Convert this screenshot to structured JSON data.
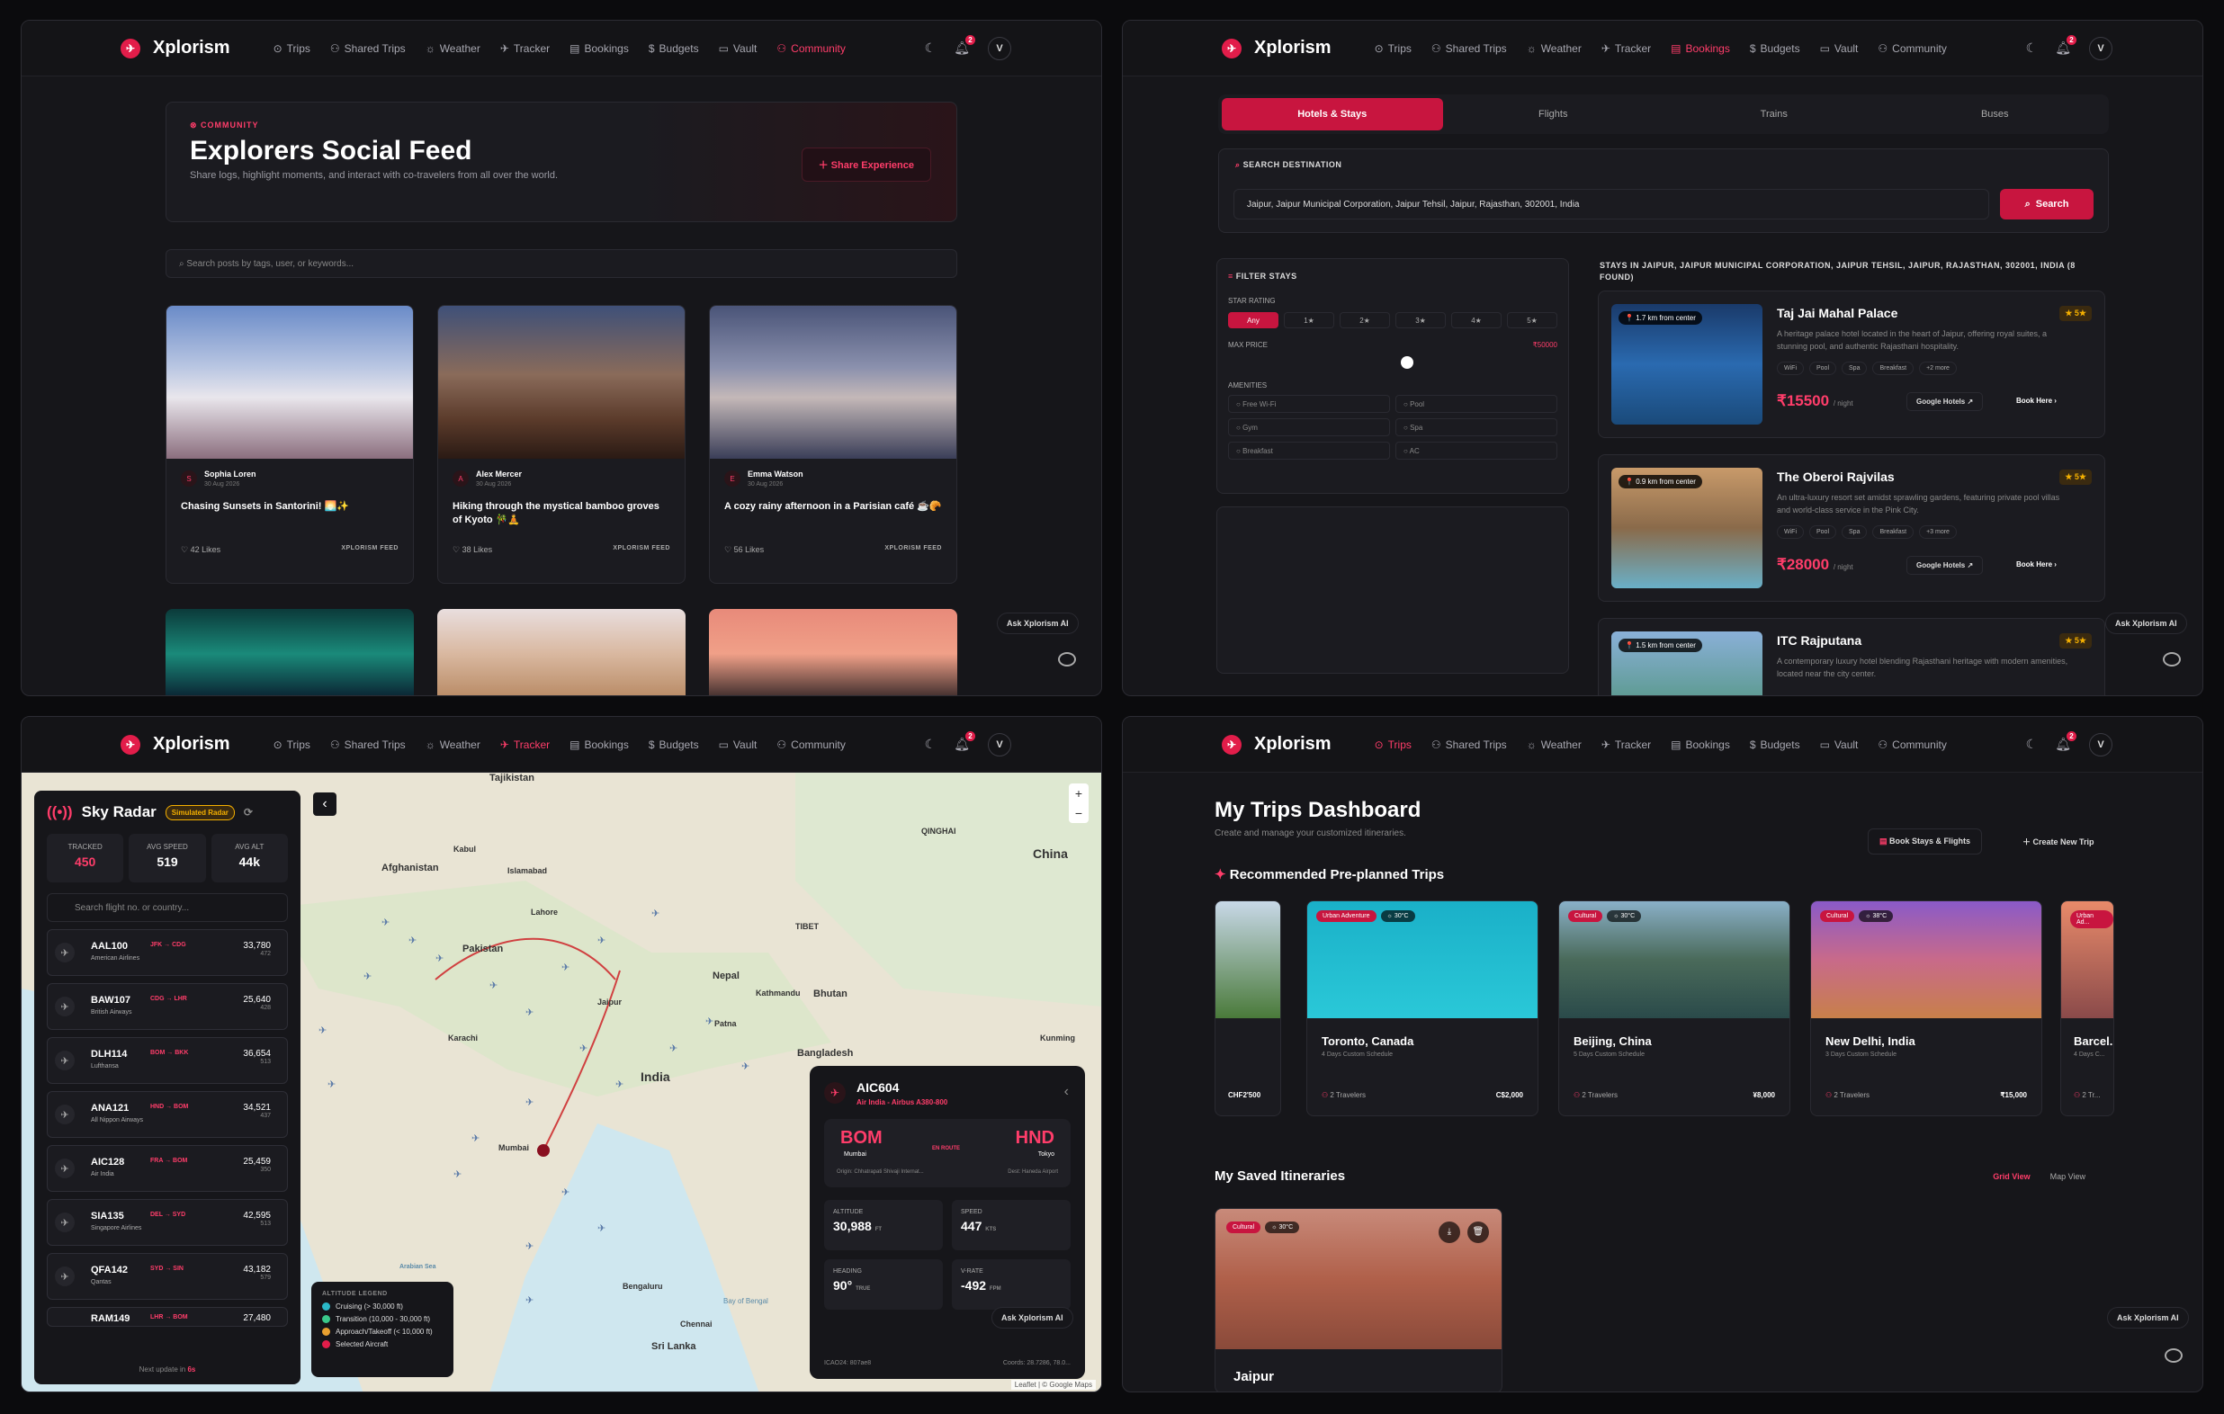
{
  "app": {
    "name": "Xplorism",
    "avatar": "V",
    "notif_count": "2"
  },
  "nav": {
    "trips": "Trips",
    "shared": "Shared Trips",
    "weather": "Weather",
    "tracker": "Tracker",
    "bookings": "Bookings",
    "budgets": "Budgets",
    "vault": "Vault",
    "community": "Community"
  },
  "community": {
    "tag": "COMMUNITY",
    "title": "Explorers Social Feed",
    "subtitle": "Share logs, highlight moments, and interact with co-travelers from all over the world.",
    "share_label": "Share Experience",
    "search_placeholder": "Search posts by tags, user, or keywords...",
    "posts": [
      {
        "initial": "S",
        "author": "Sophia Loren",
        "date": "30 Aug 2026",
        "title": "Chasing Sunsets in Santorini! 🌅✨",
        "likes": "42 Likes",
        "src": "XPLORISM FEED"
      },
      {
        "initial": "A",
        "author": "Alex Mercer",
        "date": "30 Aug 2026",
        "title": "Hiking through the mystical bamboo groves of Kyoto 🎋🧘",
        "likes": "38 Likes",
        "src": "XPLORISM FEED"
      },
      {
        "initial": "E",
        "author": "Emma Watson",
        "date": "30 Aug 2026",
        "title": "A cozy rainy afternoon in a Parisian café ☕🥐",
        "likes": "56 Likes",
        "src": "XPLORISM FEED"
      }
    ],
    "ask_ai": "Ask Xplorism AI"
  },
  "bookings": {
    "tabs": [
      "Hotels & Stays",
      "Flights",
      "Trains",
      "Buses"
    ],
    "search_label": "SEARCH DESTINATION",
    "search_value": "Jaipur, Jaipur Municipal Corporation, Jaipur Tehsil, Jaipur, Rajasthan, 302001, India",
    "search_btn": "Search",
    "filter_title": "FILTER STAYS",
    "star_label": "STAR RATING",
    "stars": [
      "Any",
      "1★",
      "2★",
      "3★",
      "4★",
      "5★"
    ],
    "max_price_label": "MAX PRICE",
    "max_price": "₹50000",
    "amenities_label": "AMENITIES",
    "amenities": [
      "Free Wi-Fi",
      "Pool",
      "Gym",
      "Spa",
      "Breakfast",
      "AC"
    ],
    "results_title": "STAYS IN JAIPUR, JAIPUR MUNICIPAL CORPORATION, JAIPUR TEHSIL, JAIPUR, RAJASTHAN, 302001, INDIA (8 FOUND)",
    "hotels": [
      {
        "dist": "1.7 km from center",
        "name": "Taj Jai Mahal Palace",
        "rating": "5★",
        "desc": "A heritage palace hotel located in the heart of Jaipur, offering royal suites, a stunning pool, and authentic Rajasthani hospitality.",
        "chips": [
          "WiFi",
          "Pool",
          "Spa",
          "Breakfast",
          "+2 more"
        ],
        "price": "₹15500",
        "per": "/ night",
        "google": "Google Hotels",
        "book": "Book Here"
      },
      {
        "dist": "0.9 km from center",
        "name": "The Oberoi Rajvilas",
        "rating": "5★",
        "desc": "An ultra-luxury resort set amidst sprawling gardens, featuring private pool villas and world-class service in the Pink City.",
        "chips": [
          "WiFi",
          "Pool",
          "Spa",
          "Breakfast",
          "+3 more"
        ],
        "price": "₹28000",
        "per": "/ night",
        "google": "Google Hotels",
        "book": "Book Here"
      },
      {
        "dist": "1.5 km from center",
        "name": "ITC Rajputana",
        "rating": "5★",
        "desc": "A contemporary luxury hotel blending Rajasthani heritage with modern amenities, located near the city center.",
        "chips": [],
        "price": "",
        "per": "",
        "google": "",
        "book": ""
      }
    ]
  },
  "tracker": {
    "title": "Sky Radar",
    "badge": "Simulated Radar",
    "tracked_label": "TRACKED",
    "tracked": "450",
    "speed_label": "AVG SPEED",
    "speed": "519",
    "alt_label": "AVG ALT",
    "alt": "44k",
    "search_placeholder": "Search flight no. or country...",
    "flights": [
      {
        "code": "AAL100",
        "route": "JFK → CDG",
        "airline": "American Airlines",
        "alt": "33,780",
        "spd": "472"
      },
      {
        "code": "BAW107",
        "route": "CDG → LHR",
        "airline": "British Airways",
        "alt": "25,640",
        "spd": "428"
      },
      {
        "code": "DLH114",
        "route": "BOM → BKK",
        "airline": "Lufthansa",
        "alt": "36,654",
        "spd": "513"
      },
      {
        "code": "ANA121",
        "route": "HND → BOM",
        "airline": "All Nippon Airways",
        "alt": "34,521",
        "spd": "437"
      },
      {
        "code": "AIC128",
        "route": "FRA → BOM",
        "airline": "Air India",
        "alt": "25,459",
        "spd": "350"
      },
      {
        "code": "SIA135",
        "route": "DEL → SYD",
        "airline": "Singapore Airlines",
        "alt": "42,595",
        "spd": "513"
      },
      {
        "code": "QFA142",
        "route": "SYD → SIN",
        "airline": "Qantas",
        "alt": "43,182",
        "spd": "579"
      },
      {
        "code": "RAM149",
        "route": "LHR → BOM",
        "airline": "",
        "alt": "27,480",
        "spd": ""
      }
    ],
    "next_update": "Next update in",
    "next_secs": "6s",
    "legend_title": "ALTITUDE LEGEND",
    "legend": [
      "Cruising (> 30,000 ft)",
      "Transition (10,000 - 30,000 ft)",
      "Approach/Takeoff (< 10,000 ft)",
      "Selected Aircraft"
    ],
    "map_labels": [
      "Tajikistan",
      "Afghanistan",
      "Pakistan",
      "Nepal",
      "Bhutan",
      "India",
      "Bangladesh",
      "China",
      "Mumbai",
      "Sri Lanka",
      "Karachi",
      "Lahore",
      "Jaipur",
      "Kathmandu",
      "Patna",
      "Bay of Bengal",
      "Arabian Sea",
      "Bengaluru",
      "Chennai",
      "Kunming",
      "QINGHAI",
      "Islamabad",
      "Kabul",
      "TIBET"
    ],
    "selected": {
      "code": "AIC604",
      "airline": "Air India - Airbus A380-800",
      "from": "BOM",
      "from_city": "Mumbai",
      "to": "HND",
      "to_city": "Tokyo",
      "status": "EN ROUTE",
      "origin": "Origin: Chhatrapati Shivaji Internat...",
      "dest": "Dest: Haneda Airport",
      "alt_label": "ALTITUDE",
      "alt": "30,988",
      "alt_u": "FT",
      "spd_label": "SPEED",
      "spd": "447",
      "spd_u": "KTS",
      "hdg_label": "HEADING",
      "hdg": "90°",
      "hdg_u": "TRUE",
      "vr_label": "V-RATE",
      "vr": "-492",
      "vr_u": "FPM",
      "icao": "ICAO24: 807ae8",
      "coords": "Coords: 28.7286, 78.0..."
    },
    "attribution": "Leaflet | © Google Maps"
  },
  "trips": {
    "title": "My Trips Dashboard",
    "subtitle": "Create and manage your customized itineraries.",
    "book_btn": "Book Stays & Flights",
    "create_btn": "Create New Trip",
    "rec_title": "Recommended Pre-planned Trips",
    "cards": [
      {
        "tag": "Urban Adventure",
        "temp": "30°C",
        "name": "Toronto, Canada",
        "days": "4 Days Custom Schedule",
        "travelers": "2 Travelers",
        "price": "C$2,000"
      },
      {
        "tag": "Cultural",
        "temp": "30°C",
        "name": "Beijing, China",
        "days": "5 Days Custom Schedule",
        "travelers": "2 Travelers",
        "price": "¥8,000"
      },
      {
        "tag": "Cultural",
        "temp": "38°C",
        "name": "New Delhi, India",
        "days": "3 Days Custom Schedule",
        "travelers": "2 Travelers",
        "price": "₹15,000"
      },
      {
        "tag": "Urban Ad...",
        "temp": "",
        "name": "Barcel...",
        "days": "4 Days C...",
        "travelers": "2 Tr...",
        "price": ""
      }
    ],
    "partial_price": "CHF2'500",
    "saved_title": "My Saved Itineraries",
    "grid_view": "Grid View",
    "map_view": "Map View",
    "saved": {
      "tag": "Cultural",
      "temp": "30°C",
      "name": "Jaipur"
    }
  },
  "colors": {
    "accent": "#e21d4a",
    "bg": "#16161a"
  }
}
